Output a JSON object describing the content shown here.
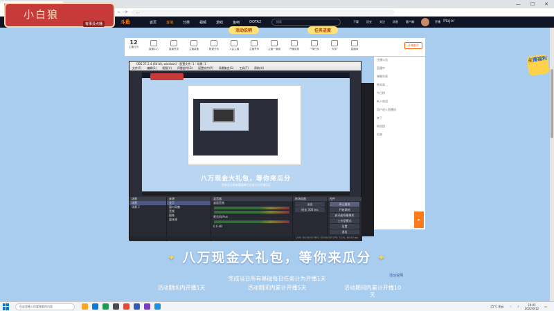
{
  "browser": {
    "tabs": [
      {
        "label": "...",
        "active": true
      },
      {
        "label": "...",
        "active": false
      }
    ],
    "url": "...",
    "window_controls": {
      "minimize": "—",
      "maximize": "☐",
      "close": "✕"
    }
  },
  "overlay": {
    "name": "小白狼",
    "sub": "有事没点播"
  },
  "site_nav": {
    "logo": "斗鱼",
    "items": [
      {
        "label": "首页",
        "active": false
      },
      {
        "label": "直播",
        "active": true
      },
      {
        "label": "分类",
        "active": false
      },
      {
        "label": "视频",
        "active": false
      },
      {
        "label": "游戏",
        "active": false
      },
      {
        "label": "鱼吧",
        "active": false
      },
      {
        "label": "DOTA2",
        "active": false
      }
    ],
    "search_placeholder": "搜索",
    "right_items": [
      "下载",
      "历史",
      "关注",
      "消息",
      "客户端",
      "钱包",
      "开播"
    ],
    "user": "Major"
  },
  "event_pills": [
    "活动说明",
    "任务进度"
  ],
  "room_toolbar": {
    "date_day": "12",
    "date_label": "主播日历",
    "items": [
      "直播中心",
      "直播任务",
      "主播装备",
      "数据分析",
      "入会主播",
      "主播专享",
      "主播一道道",
      "开播奖励",
      "一周任务",
      "财务",
      "直播间"
    ],
    "live_button": "开播助手"
  },
  "chat_rows": [
    "主播公告",
    "直播中",
    "弹幕列表",
    "贵宾席",
    "今日榜",
    "新人欢迎",
    "用户进入直播间",
    "来了",
    "粉丝团",
    "礼物"
  ],
  "obs": {
    "title": "OBS 27.2.4 (64-bit, windows) - 配置文件: 1 - 场景: 1",
    "menu": [
      "文件(F)",
      "编辑(E)",
      "视图(V)",
      "停靠部件(D)",
      "配置文件(P)",
      "场景集合(S)",
      "工具(T)",
      "帮助(H)"
    ],
    "preview_banner": "八万现金大礼包，等你来瓜分",
    "preview_sub": "完成当日所有基础每日任务计为开播1天",
    "docks": {
      "scenes": {
        "header": "场景",
        "items": [
          "场景",
          "场景 2"
        ]
      },
      "sources": {
        "header": "来源",
        "items": [
          "显示",
          "窗口采集",
          "音频",
          "图像",
          "媒体源"
        ]
      },
      "mixer": {
        "header": "混音器",
        "items": [
          "桌面音频",
          "麦克风/Aux"
        ],
        "level": "0.0 dB"
      },
      "transitions": {
        "header": "转场动画",
        "items": [
          "淡出",
          "时长 300 ms"
        ]
      },
      "controls": {
        "header": "控件",
        "items": [
          {
            "label": "停止推流",
            "highlight": true
          },
          {
            "label": "开始录制",
            "highlight": false
          },
          {
            "label": "启动虚拟摄像机",
            "highlight": false
          },
          {
            "label": "工作室模式",
            "highlight": false
          },
          {
            "label": "设置",
            "highlight": false
          },
          {
            "label": "退出",
            "highlight": false
          }
        ]
      }
    },
    "status": "LIVE: 00:00:00   REC: 00:00:00   CPU: 3.1%, 60.00 fps"
  },
  "banner": {
    "title": "八万现金大礼包，等你来瓜分",
    "subtitle": "完成当日所有基础每日任务计为开播1天",
    "rule_link": "活动说明",
    "tasks": [
      "活动期间内开播1天",
      "活动期间内累计开播5天",
      "活动期间内累计开播10天"
    ]
  },
  "sticker": "主播福利",
  "taskbar": {
    "search_placeholder": "在这里输入你要搜索的内容",
    "weather": "25°C 多云",
    "time": "19:01",
    "date": "2022/6/12"
  }
}
